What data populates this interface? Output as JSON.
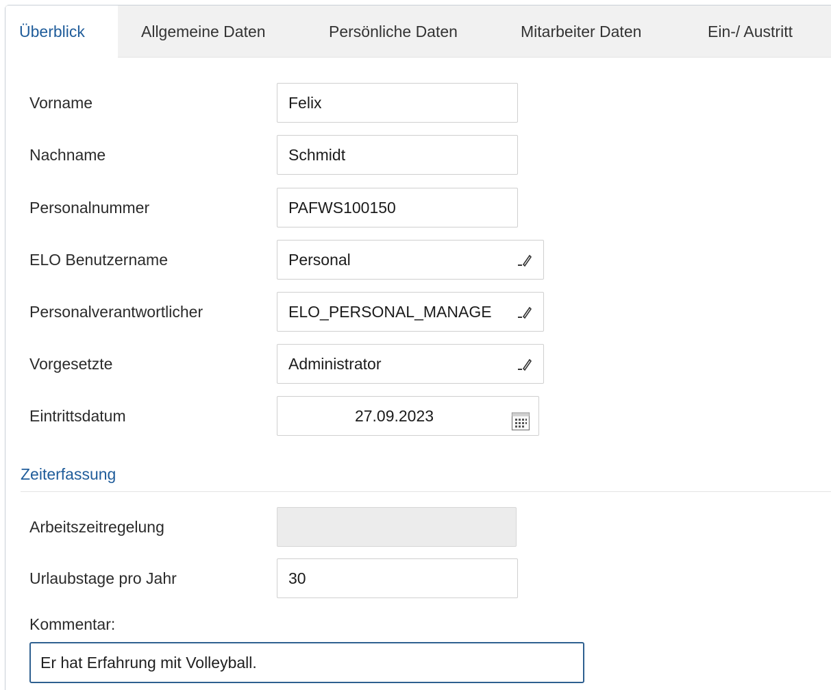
{
  "tabs": [
    {
      "label": "Überblick"
    },
    {
      "label": "Allgemeine Daten"
    },
    {
      "label": "Persönliche Daten"
    },
    {
      "label": "Mitarbeiter Daten"
    },
    {
      "label": "Ein-/ Austritt"
    }
  ],
  "fields": {
    "vorname": {
      "label": "Vorname",
      "value": "Felix"
    },
    "nachname": {
      "label": "Nachname",
      "value": "Schmidt"
    },
    "personalnummer": {
      "label": "Personalnummer",
      "value": "PAFWS100150"
    },
    "benutzername": {
      "label": "ELO Benutzername",
      "value": "Personal"
    },
    "verantwortlicher": {
      "label": "Personalverantwortlicher",
      "value": "ELO_PERSONAL_MANAGE"
    },
    "vorgesetzte": {
      "label": "Vorgesetzte",
      "value": "Administrator"
    },
    "eintrittsdatum": {
      "label": "Eintrittsdatum",
      "value": "27.09.2023"
    }
  },
  "zeiterfassung": {
    "title": "Zeiterfassung",
    "arbeitszeit": {
      "label": "Arbeitszeitregelung",
      "value": ""
    },
    "urlaub": {
      "label": "Urlaubstage pro Jahr",
      "value": "30"
    }
  },
  "kommentar": {
    "label": "Kommentar:",
    "value": "Er hat Erfahrung mit Volleyball."
  },
  "icons": {
    "edit": "pencil-icon",
    "calendar": "calendar-icon"
  },
  "colors": {
    "accent": "#1f5c9a",
    "tabbar_bg": "#f1f1f1",
    "comment_border": "#2d5f8f"
  }
}
